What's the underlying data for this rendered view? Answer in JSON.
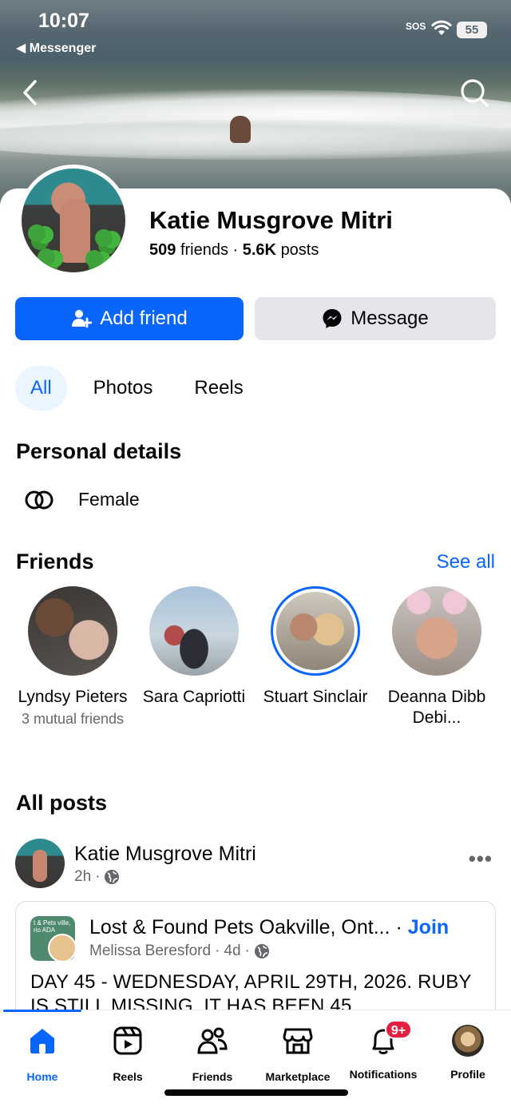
{
  "status_bar": {
    "time": "10:07",
    "back_app": "◀ Messenger",
    "sos": "SOS",
    "battery": "55"
  },
  "profile": {
    "name": "Katie Musgrove Mitri",
    "friends_count": "509",
    "friends_word": "friends",
    "separator": " · ",
    "posts_count": "5.6K",
    "posts_word": "posts"
  },
  "actions": {
    "add_friend": "Add friend",
    "message": "Message"
  },
  "tabs": [
    {
      "label": "All",
      "active": true
    },
    {
      "label": "Photos",
      "active": false
    },
    {
      "label": "Reels",
      "active": false
    }
  ],
  "personal_details": {
    "heading": "Personal details",
    "gender": "Female"
  },
  "friends_section": {
    "heading": "Friends",
    "see_all": "See all",
    "items": [
      {
        "name": "Lyndsy Pieters",
        "mutual": "3 mutual friends",
        "story": false
      },
      {
        "name": "Sara Capriotti",
        "mutual": "",
        "story": false
      },
      {
        "name": "Stuart Sinclair",
        "mutual": "",
        "story": true
      },
      {
        "name": "Deanna Dibb Debi...",
        "mutual": "",
        "story": false
      }
    ]
  },
  "posts": {
    "heading": "All posts",
    "first": {
      "author": "Katie Musgrove Mitri",
      "time": "2h",
      "more": "•••",
      "shared": {
        "group": "Lost & Found Pets Oakville, Ont...",
        "dot": " · ",
        "join": "Join",
        "poster": "Melissa Beresford",
        "time": "4d",
        "text": "DAY 45 - WEDNESDAY, APRIL 29TH, 2026. RUBY IS STILL MISSING. IT HAS BEEN 45",
        "group_avatar_text": "t & Pets ville, rio ADA"
      }
    }
  },
  "tabbar": {
    "items": [
      {
        "label": "Home",
        "icon": "home-icon",
        "active": true
      },
      {
        "label": "Reels",
        "icon": "reels-icon",
        "active": false
      },
      {
        "label": "Friends",
        "icon": "friends-icon",
        "active": false
      },
      {
        "label": "Marketplace",
        "icon": "marketplace-icon",
        "active": false
      },
      {
        "label": "Notifications",
        "icon": "bell-icon",
        "active": false,
        "badge": "9+"
      },
      {
        "label": "Profile",
        "icon": "profile-avatar",
        "active": false
      }
    ]
  },
  "colors": {
    "accent": "#0866ff",
    "badge": "#e41e3f",
    "muted": "#65676b",
    "button_gray": "#e4e6eb"
  }
}
